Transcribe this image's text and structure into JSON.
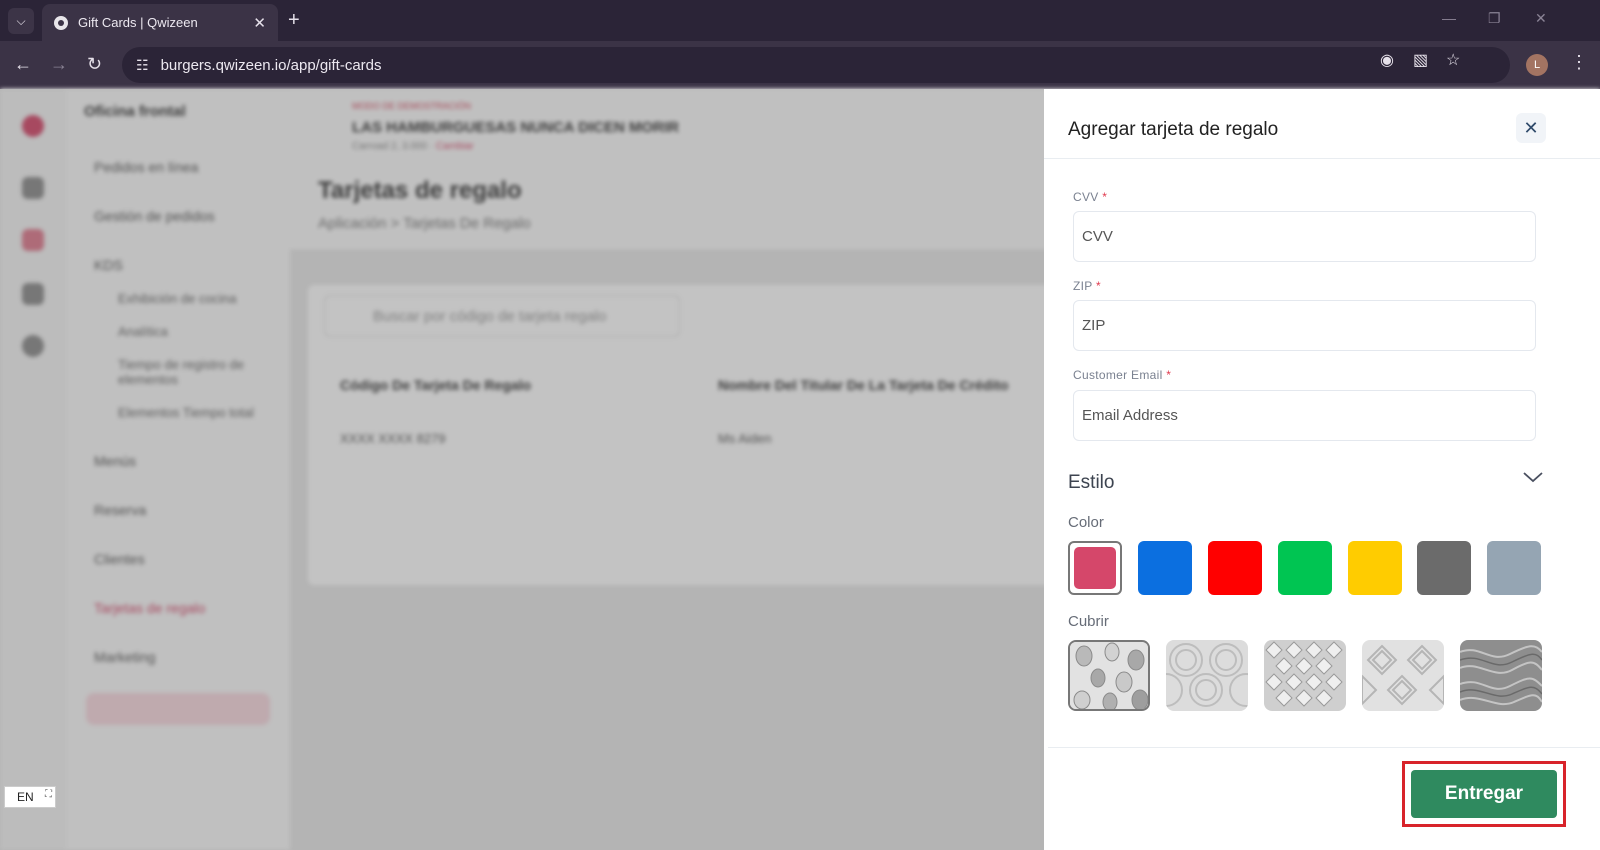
{
  "browser": {
    "tab_title": "Gift Cards | Qwizeen",
    "tab_list_icon": "chevron-down-icon",
    "url": "burgers.qwizeen.io/app/gift-cards",
    "profile_initial": "L"
  },
  "app": {
    "sidebar_title": "Oficina frontal",
    "sidebar_items": [
      {
        "label": "Pedidos en línea"
      },
      {
        "label": "Gestión de pedidos"
      },
      {
        "label": "KDS"
      },
      {
        "label": "Menús"
      },
      {
        "label": "Reserva"
      },
      {
        "label": "Clientes"
      },
      {
        "label": "Tarjetas de regalo"
      },
      {
        "label": "Marketing"
      }
    ],
    "sidebar_subitems": [
      {
        "label": "Exhibición de cocina"
      },
      {
        "label": "Analítica"
      },
      {
        "label": "Tiempo de registro de elementos"
      },
      {
        "label": "Elementos Tiempo total"
      }
    ],
    "store_tag": "MODO DE DEMOSTRACIÓN",
    "store_name": "LAS HAMBURGUESAS NUNCA DICEN MORIR",
    "store_sub_prefix": "Carroad 2, 3.000 ·",
    "store_sub_link": "Cambiar",
    "page_title": "Tarjetas de regalo",
    "breadcrumb": [
      "Aplicación",
      "Tarjetas De Regalo"
    ],
    "search_placeholder": "Buscar por código de tarjeta regalo",
    "table": {
      "headers": [
        "Código De Tarjeta De Regalo",
        "Nombre Del Titular De La Tarjeta De Crédito"
      ],
      "rows": [
        [
          "XXXX XXXX 8279",
          "Ms Aiden"
        ]
      ]
    },
    "language": "EN"
  },
  "drawer": {
    "title": "Agregar tarjeta de regalo",
    "fields": {
      "cvv": {
        "label": "CVV",
        "placeholder": "CVV",
        "value": ""
      },
      "zip": {
        "label": "ZIP",
        "placeholder": "ZIP",
        "value": ""
      },
      "email": {
        "label": "Customer Email",
        "placeholder": "Email Address",
        "value": ""
      }
    },
    "required_mark": "*",
    "style_section": "Estilo",
    "color_label": "Color",
    "colors": [
      "#d5476a",
      "#0b6fe0",
      "#ff0000",
      "#00c552",
      "#ffcc00",
      "#6b6b6b",
      "#95a5b3"
    ],
    "selected_color": "#d5476a",
    "cover_label": "Cubrir",
    "covers": [
      "pattern-leaves",
      "pattern-waves",
      "pattern-geometric",
      "pattern-chevrons",
      "pattern-marble"
    ],
    "selected_cover": "pattern-leaves",
    "submit_label": "Entregar"
  }
}
